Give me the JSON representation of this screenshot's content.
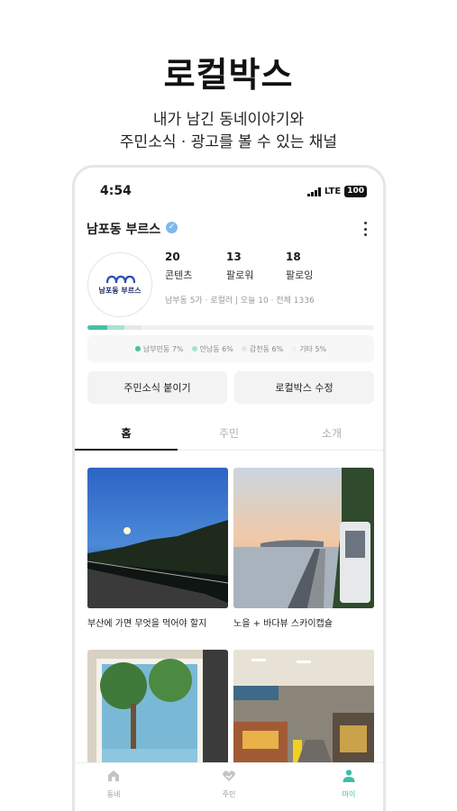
{
  "promo": {
    "title": "로컬박스",
    "subtitle_line1": "내가 남긴 동네이야기와",
    "subtitle_line2": "주민소식 · 광고를 볼 수 있는 채널"
  },
  "status_bar": {
    "time": "4:54",
    "network": "LTE",
    "battery": "100"
  },
  "profile": {
    "name": "남포동 부르스",
    "avatar_text": "남포동 부르스",
    "stats": [
      {
        "value": "20",
        "label": "콘텐츠"
      },
      {
        "value": "13",
        "label": "팔로워"
      },
      {
        "value": "18",
        "label": "팔로잉"
      }
    ],
    "meta": "남부동 5가 · 로컬러 | 오늘 10 · 전체 1336"
  },
  "distribution": {
    "items": [
      {
        "label": "남부민동 7%",
        "value": 7,
        "color": "#48bfa3"
      },
      {
        "label": "안남동 6%",
        "value": 6,
        "color": "#a9e1d3"
      },
      {
        "label": "감천동 6%",
        "value": 6,
        "color": "#e7e7e7"
      },
      {
        "label": "기타 5%",
        "value": 5,
        "color": "#f1f1f1"
      }
    ]
  },
  "actions": {
    "post_news": "주민소식 붙이기",
    "edit_box": "로컬박스 수정"
  },
  "tabs": [
    {
      "label": "홈",
      "active": true
    },
    {
      "label": "주민",
      "active": false
    },
    {
      "label": "소개",
      "active": false
    }
  ],
  "posts": [
    {
      "caption": "부산에 가면 무엇을 먹어야 할지"
    },
    {
      "caption": "노을 + 바다뷰 스카이캡슐"
    },
    {
      "caption": ""
    },
    {
      "caption": ""
    }
  ],
  "bottom_nav": [
    {
      "label": "동네",
      "icon": "home-icon",
      "active": false
    },
    {
      "label": "주민",
      "icon": "heart-hands-icon",
      "active": false
    },
    {
      "label": "마이",
      "icon": "person-icon",
      "active": true
    }
  ]
}
